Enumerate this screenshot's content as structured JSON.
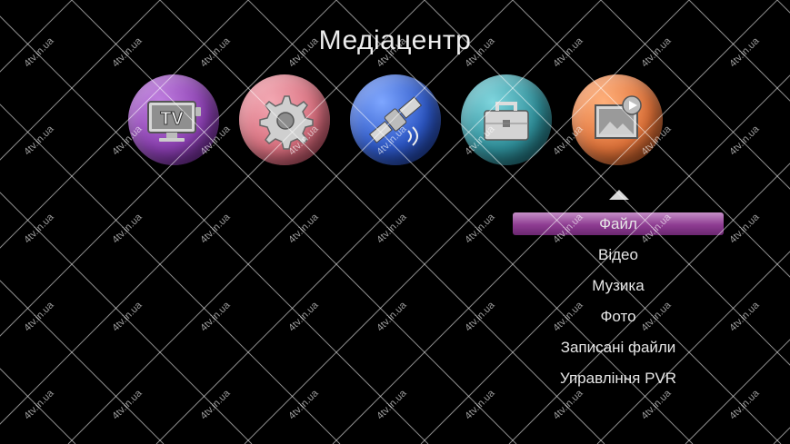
{
  "header": {
    "title": "Медіацентр"
  },
  "icons": [
    {
      "name": "tv",
      "icon": "tv-icon",
      "label": "TV",
      "color": "#8a3fb0"
    },
    {
      "name": "settings",
      "icon": "gear-icon",
      "color": "#d9707f"
    },
    {
      "name": "satellite",
      "icon": "satellite-icon",
      "color": "#2d58c7"
    },
    {
      "name": "tools",
      "icon": "toolbox-icon",
      "color": "#2f8f9a"
    },
    {
      "name": "media",
      "icon": "picture-play-icon",
      "color": "#e0733a"
    }
  ],
  "menu": {
    "scroll_up": "triangle-up-icon",
    "items": [
      {
        "label": "Файл",
        "selected": true
      },
      {
        "label": "Відео"
      },
      {
        "label": "Музика"
      },
      {
        "label": "Фото"
      },
      {
        "label": "Записані файли"
      },
      {
        "label": "Управління PVR"
      }
    ],
    "highlight_color": "#8e3c92"
  },
  "watermark": {
    "text": "4tv.in.ua"
  }
}
